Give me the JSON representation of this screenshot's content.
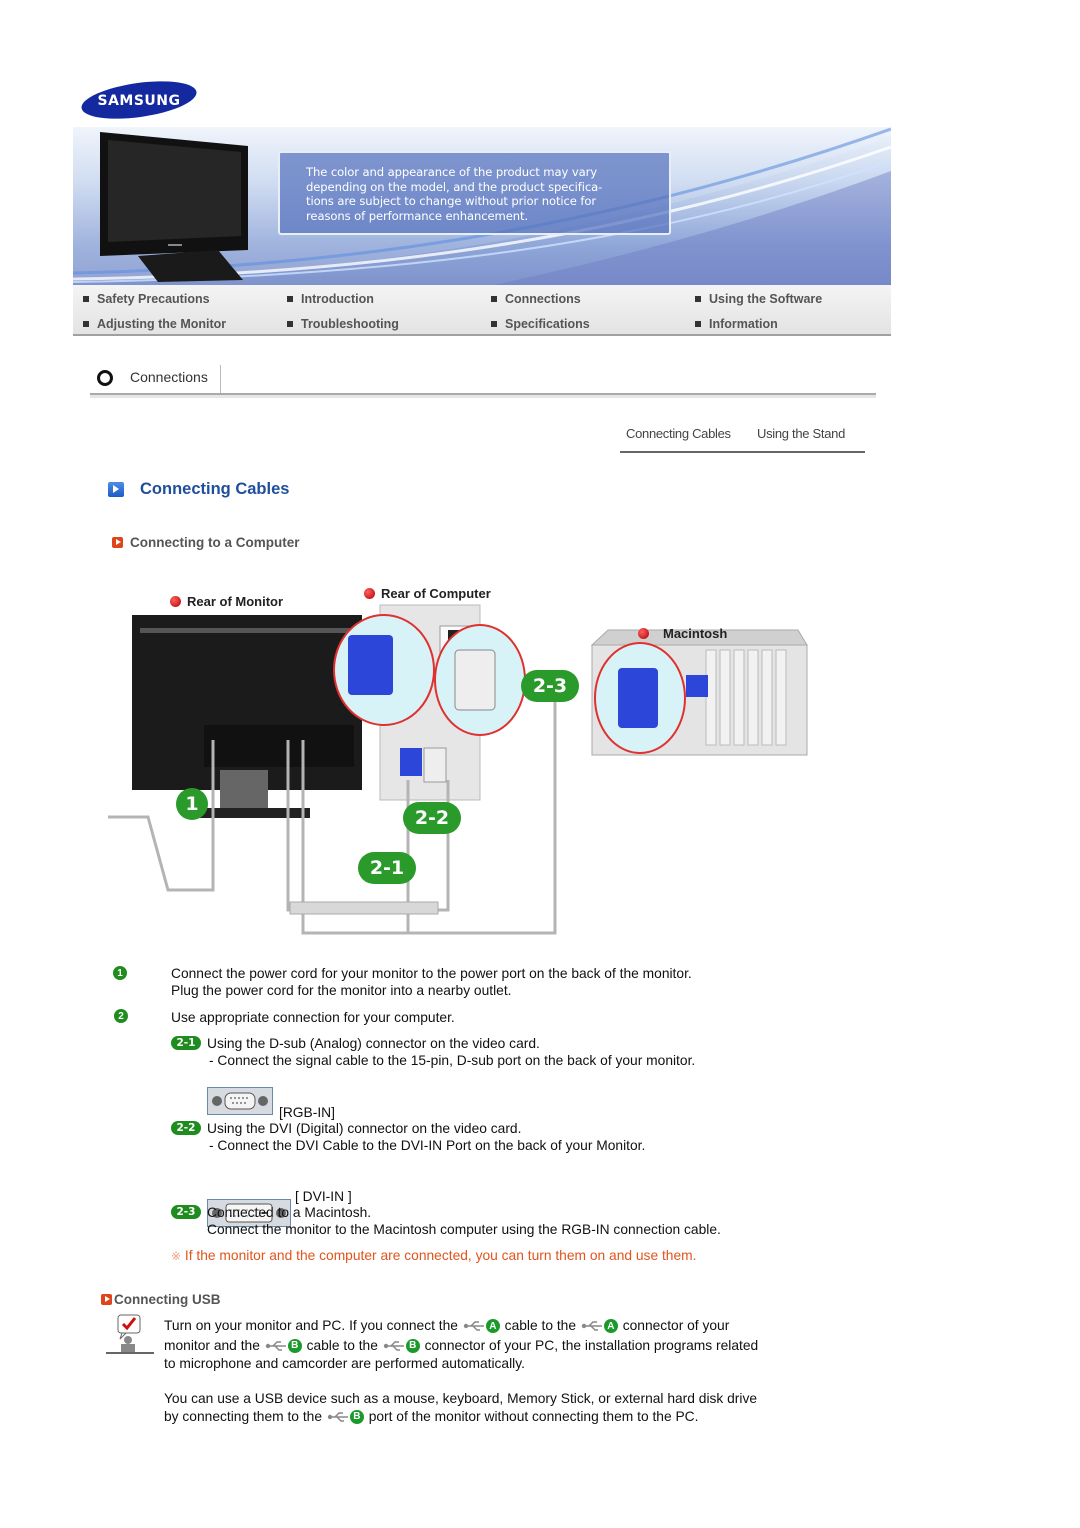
{
  "brand": {
    "logo_text": "SAMSUNG"
  },
  "banner": {
    "notice_lines": [
      "The color and appearance of the product may vary",
      "depending on the model, and the product specifica-",
      "tions are subject to change without prior notice for",
      "reasons of performance enhancement."
    ]
  },
  "nav": {
    "items": [
      {
        "label": "Safety Precautions"
      },
      {
        "label": "Introduction"
      },
      {
        "label": "Connections"
      },
      {
        "label": "Using the Software"
      },
      {
        "label": "Adjusting the Monitor"
      },
      {
        "label": "Troubleshooting"
      },
      {
        "label": "Specifications"
      },
      {
        "label": "Information"
      }
    ]
  },
  "section": {
    "title": "Connections"
  },
  "subtabs": [
    {
      "label": "Connecting Cables",
      "active": true
    },
    {
      "label": "Using the Stand",
      "active": false
    }
  ],
  "main": {
    "heading": "Connecting Cables",
    "subheading_computer": "Connecting to a Computer",
    "diagram": {
      "labels": {
        "rear_monitor": "Rear of Monitor",
        "rear_computer": "Rear of Computer",
        "macintosh": "Macintosh"
      },
      "badges": [
        "1",
        "2-1",
        "2-2",
        "2-3"
      ]
    },
    "steps": {
      "step1_num": "1",
      "step1_line1": "Connect the power cord for your monitor to the power port on the back of the monitor.",
      "step1_line2": "Plug the power cord for the monitor into a nearby outlet.",
      "step2_num": "2",
      "step2_line1": "Use appropriate connection for your computer.",
      "s21_badge": "2-1",
      "s21_line1": "Using the D-sub (Analog) connector on the video card.",
      "s21_line2": "- Connect the signal cable to the 15-pin, D-sub port on the back of your monitor.",
      "s21_port_label": "[RGB-IN]",
      "s22_badge": "2-2",
      "s22_line1": "Using the DVI (Digital) connector on the video card.",
      "s22_line2": "- Connect the DVI Cable to the DVI-IN Port on the back of your Monitor.",
      "s22_port_label": "[ DVI-IN ]",
      "s23_badge": "2-3",
      "s23_line1": "Connected to a Macintosh.",
      "s23_line2": "Connect the monitor to the Macintosh computer using the RGB-IN connection cable."
    },
    "note_symbol": "※",
    "note": "If the monitor and the computer are connected, you can turn them on and use them.",
    "usb": {
      "heading": "Connecting USB",
      "p1_a": "Turn on your monitor and PC. If you connect the",
      "p1_b": "cable to the",
      "p1_c": "connector of your",
      "p1_d": "monitor and the",
      "p1_e": "cable to the",
      "p1_f": "connector of your PC, the installation programs related",
      "p1_g": "to microphone and camcorder are performed automatically.",
      "p2_a": "You can use a USB device such as a mouse, keyboard, Memory Stick, or external hard disk drive",
      "p2_b": "by connecting them to the",
      "p2_c": "port of the monitor without connecting them to the PC.",
      "letter_a": "A",
      "letter_b": "B"
    }
  },
  "colors": {
    "heading_blue": "#1f4f9c",
    "note_orange": "#e2541c",
    "badge_green": "#2a9a2a",
    "samsung_blue": "#1428a0"
  }
}
